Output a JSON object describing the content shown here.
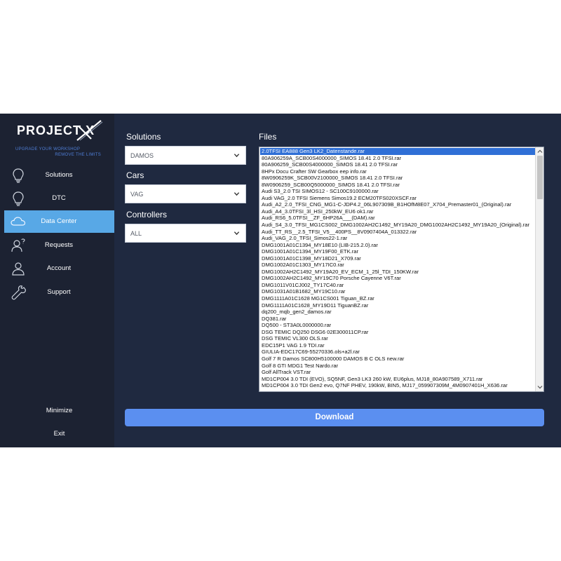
{
  "brand": {
    "name": "PROJECT X",
    "tagline_line1": "UPGRADE YOUR WORKSHOP",
    "tagline_line2": "REMOVE THE LIMITS"
  },
  "colors": {
    "app_bg": "#1f2940",
    "sidebar_bg": "#1c2232",
    "active_nav": "#58a8e6",
    "accent": "#5b8ff0",
    "selection": "#2f6fd6"
  },
  "sidebar": {
    "items": [
      {
        "label": "Solutions",
        "icon": "bulb-icon",
        "active": false
      },
      {
        "label": "DTC",
        "icon": "bulb-icon",
        "active": false
      },
      {
        "label": "Data Center",
        "icon": "cloud-icon",
        "active": true
      },
      {
        "label": "Requests",
        "icon": "user-question-icon",
        "active": false
      },
      {
        "label": "Account",
        "icon": "user-icon",
        "active": false
      },
      {
        "label": "Support",
        "icon": "wrench-icon",
        "active": false
      }
    ],
    "minimize_label": "Minimize",
    "exit_label": "Exit"
  },
  "filters": {
    "solutions": {
      "label": "Solutions",
      "value": "DAMOS"
    },
    "cars": {
      "label": "Cars",
      "value": "VAG"
    },
    "controllers": {
      "label": "Controllers",
      "value": "ALL"
    }
  },
  "files": {
    "label": "Files",
    "selected_index": 0,
    "items": [
      "2.0TFSI EA888 Gen3 LK2_Datenstande.rar",
      "80A906259A_SCB00S4000000_SIMOS 18.41 2.0 TFSI.rar",
      "80A906259_SCB00S4000000_SIMOS 18.41 2.0 TFSI.rar",
      "8HPx Docu Crafter SW Gearbox eep info.rar",
      "8W0906259K_SCB00V2100000_SIMOS 18.41 2.0 TFSI.rar",
      "8W0906259_SCB00Q5000000_SIMOS 18.41 2.0 TFSI.rar",
      "Audi S3_2.0 TSI SIMOS12 - SC100C9100000.rar",
      "Audi VAG_2.0 TFSI Siemens Simos19.2 ECM20TFS020XSCF.rar",
      "Audi_A2_2.0_TFSI_CNG_MG1-C-JDP4.2_06L907309B_B1HOfM8E07_X704_Premaster01_(Original).rar",
      "Audi_A4_3.0TFSI_3l_HSI_250kW_EU6 ok1.rar",
      "Audi_RS6_5.0TFSI__ZF_6HP26A___(DAM).rar",
      "Audi_S4_3.0_TFSI_MG1CS002_DMG1002AH2C1492_MY19A20_DMG1002AH2C1492_MY19A20_(Original).rar",
      "Audi_TT_RS__2.5_TFSI_V5__400PS__8V0907404A_013322.rar",
      "Audi_VAG_2.0_TFSI_Simos22-1.rar",
      "DMG1001A01C1394_MY18E10 (LIB-215.2.0).rar",
      "DMG1001A01C1394_MY19F00_ETK.rar",
      "DMG1001A01C1398_MY18D21_X709.rar",
      "DMG1002A01C1303_MY17IC0.rar",
      "DMG1002AH2C1492_MY19A20_EV_ECM_1_25l_TDI_150KW.rar",
      "DMG1002AH2C1492_MY19C70 Porsche Cayenne V6T.rar",
      "DMG1011V01CJ002_TY17C40.rar",
      "DMG1031A01B1682_MY19C10.rar",
      "DMG1111A01C1628 MG1CS001 Tiguan_BZ.rar",
      "DMG1111A01C1628_MY19D11 TiguanBZ.rar",
      "dq200_mqb_gen2_damos.rar",
      "DQ381.rar",
      "DQ500 - ST3A0L0000000.rar",
      "DSG TEMIC DQ250 DSG6 02E300011CP.rar",
      "DSG TEMIC VL300 OLS.rar",
      "EDC15P1 VAG 1.9 TDI.rar",
      "GIULIA-EDC17C69-55270336.ols+a2l.rar",
      "Golf 7 R Damos SC800H5100000 DAMOS B C OLS new.rar",
      "Golf 8 GTI MDG1 Test Nardo.rar",
      "Golf AllTrack VST.rar",
      "MD1CP004 3.0 TDI (EVO), SQ5NF, Gen3 LK3 260 kW, EU6plus, MJ18_80A907589_X711.rar",
      "MD1CP004 3.0 TDI Gen2 evo, Q7NF PHEV, 190kW, BIN5, MJ17_059907309M_4M0907401H_X636.rar"
    ]
  },
  "download_label": "Download"
}
